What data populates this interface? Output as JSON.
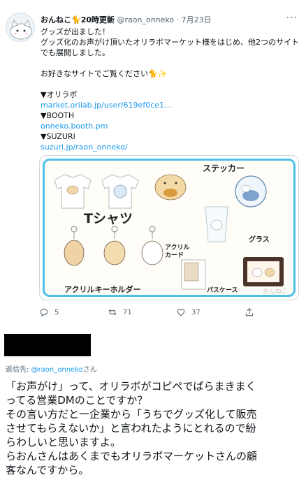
{
  "tweet": {
    "author_name": "おんねこ",
    "author_badge": "20時更新",
    "handle": "@raon_onneko",
    "date": "7月23日",
    "lines": [
      "グッズが出ました！",
      "グッズ化のお声がけ頂いたオリラボマーケット様をはじめ、他2つのサイト",
      "でも展開しました。"
    ],
    "prompt": "お好きなサイトでご覧ください",
    "shops": [
      {
        "name": "▼オリラボ",
        "url": "market.orilab.jp/user/619ef0ce1…"
      },
      {
        "name": "▼BOOTH",
        "url": "onneko.booth.pm"
      },
      {
        "name": "▼SUZURI",
        "url": "suzuri.jp/raon_onneko/"
      }
    ],
    "media": {
      "tshirt_label": "Tシャツ",
      "sticker_label": "ステッカー",
      "glass_label": "グラス",
      "acrylic_card_label": "アクリル\nカード",
      "keyholder_label": "アクリルキーホルダー",
      "pass_case_label": "パスケース",
      "watermark": "おんねこ"
    },
    "actions": {
      "replies": "5",
      "retweets": "71",
      "likes": "37"
    }
  },
  "reply": {
    "reply_prefix": "返信先:",
    "reply_handle": "@raon_onneko",
    "reply_suffix": "さん",
    "lines": [
      "「お声がけ」って、オリラボがコピペでばらまきまく",
      "ってる営業DMのことですか？",
      "その言い方だと一企業から「うちでグッズ化して販売",
      "させてもらえないか」と言われたようにとれるので紛",
      "らわしいと思いますよ。",
      "らおんさんはあくまでもオリラボマーケットさんの顧",
      "客なんですから。"
    ]
  },
  "colors": {
    "link": "#1d9bf0",
    "frame": "#4ec0e6",
    "muted": "#536471"
  }
}
